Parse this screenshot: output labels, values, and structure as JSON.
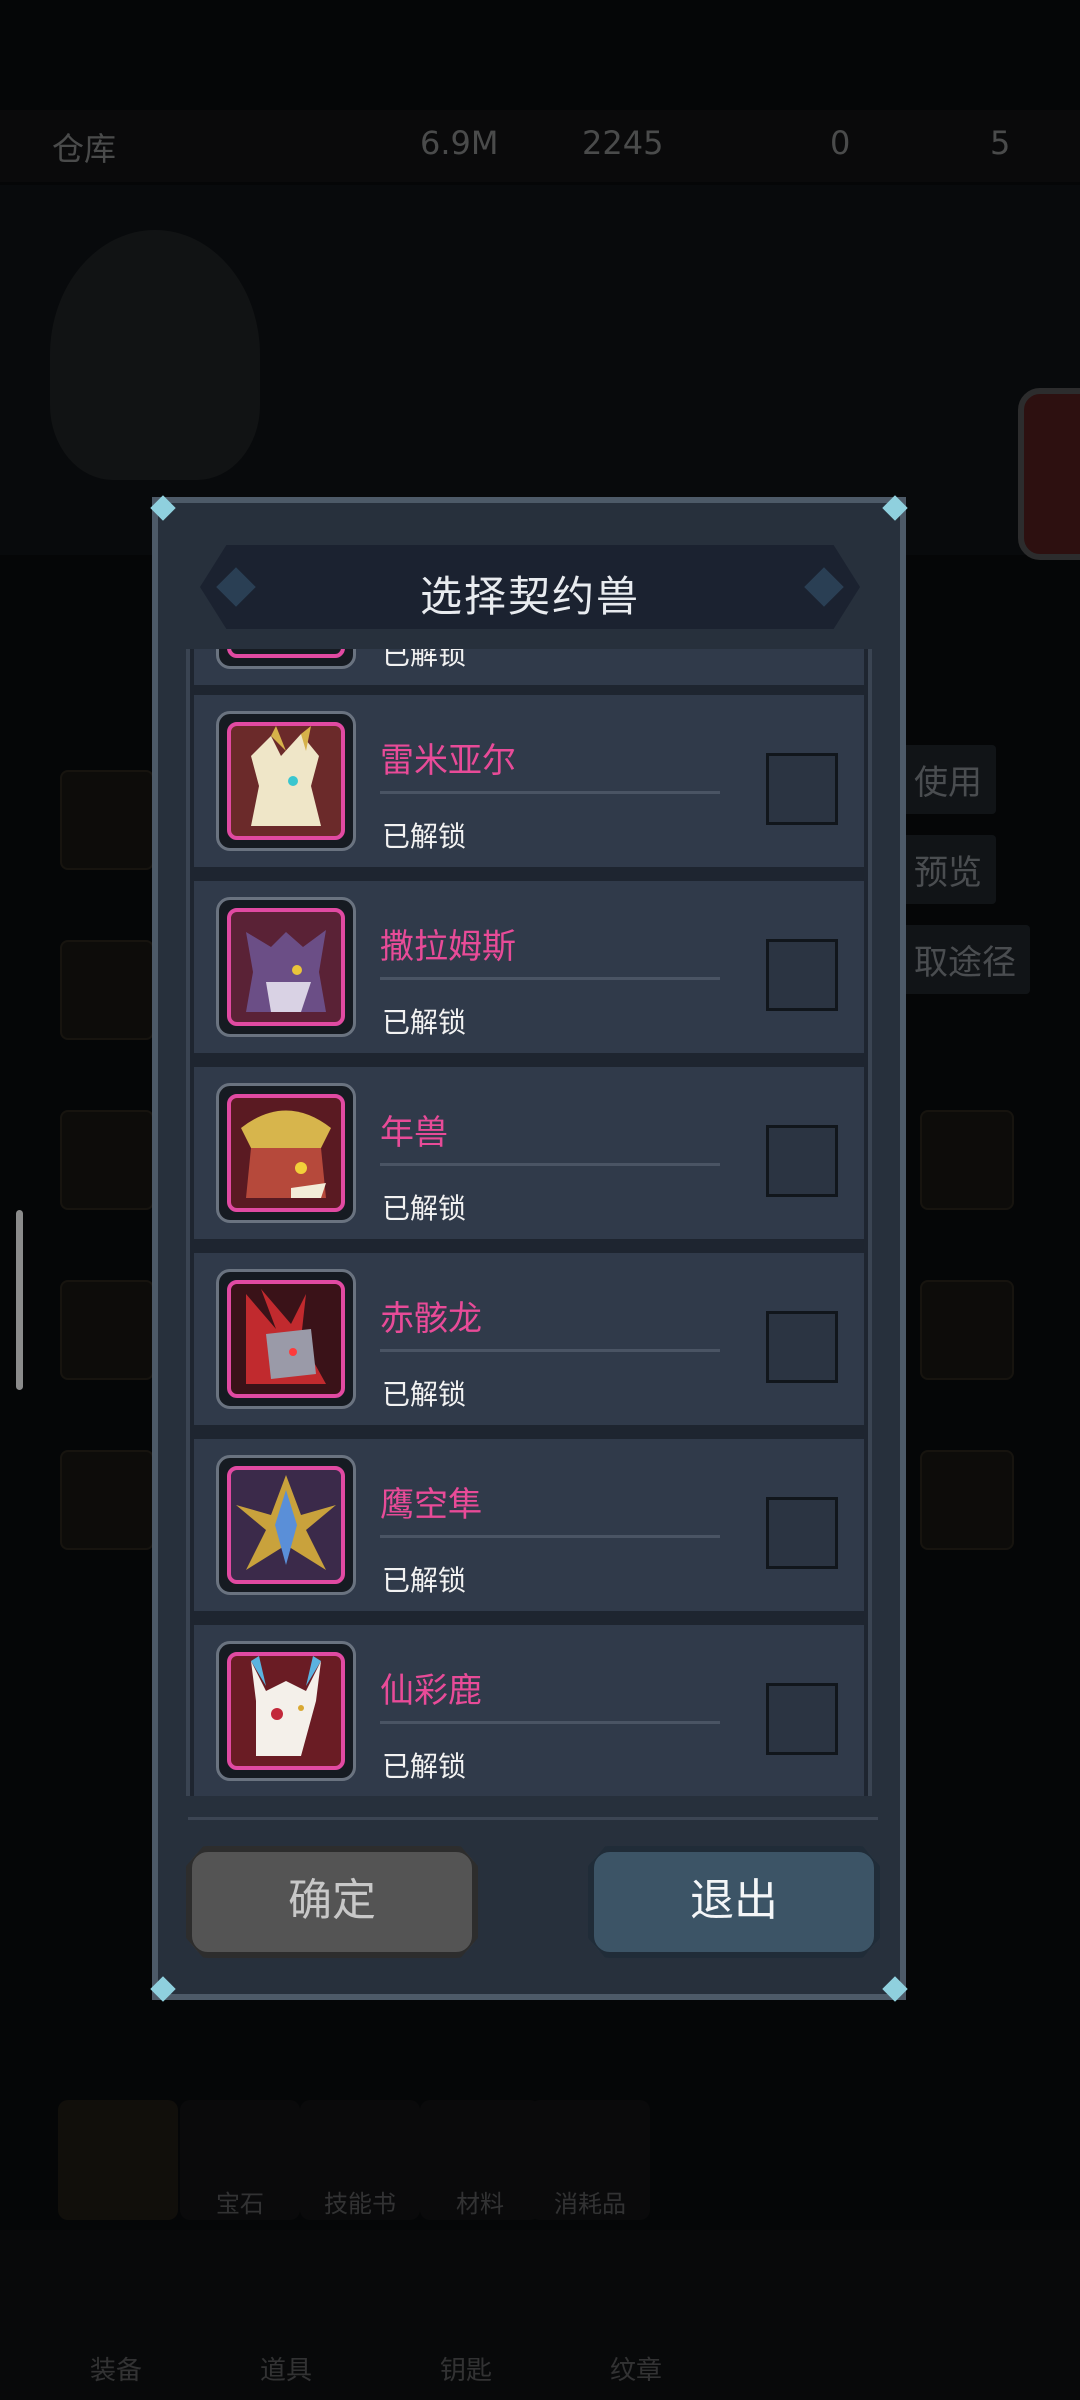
{
  "background": {
    "top_bar": {
      "title": "仓库",
      "gold": "6.9M",
      "gems": "2245",
      "stamina": "0",
      "tickets": "5"
    },
    "side_buttons": [
      "使用",
      "预览",
      "取途径"
    ],
    "categories": [
      "宝石",
      "技能书",
      "材料",
      "消耗品"
    ],
    "bottom_nav": [
      "装备",
      "道具",
      "钥匙",
      "纹章"
    ]
  },
  "dialog": {
    "title": "选择契约兽",
    "partial_row_status": "已解锁",
    "beasts": [
      {
        "name": "雷米亚尔",
        "status": "已解锁",
        "selected": false,
        "icon": "white-gold-dragon-icon"
      },
      {
        "name": "撒拉姆斯",
        "status": "已解锁",
        "selected": false,
        "icon": "purple-wolf-icon"
      },
      {
        "name": "年兽",
        "status": "已解锁",
        "selected": false,
        "icon": "red-golden-horned-beast-icon"
      },
      {
        "name": "赤骸龙",
        "status": "已解锁",
        "selected": false,
        "icon": "red-bone-dragon-icon"
      },
      {
        "name": "鹰空隼",
        "status": "已解锁",
        "selected": false,
        "icon": "blue-gold-falcon-icon"
      },
      {
        "name": "仙彩鹿",
        "status": "已解锁",
        "selected": false,
        "icon": "white-spirit-deer-icon"
      }
    ],
    "confirm_label": "确定",
    "exit_label": "退出"
  },
  "colors": {
    "name_pink": "#e84b98",
    "frame_pink": "#e14aa2",
    "dialog_bg": "#27303c",
    "row_bg": "#303a4a"
  }
}
